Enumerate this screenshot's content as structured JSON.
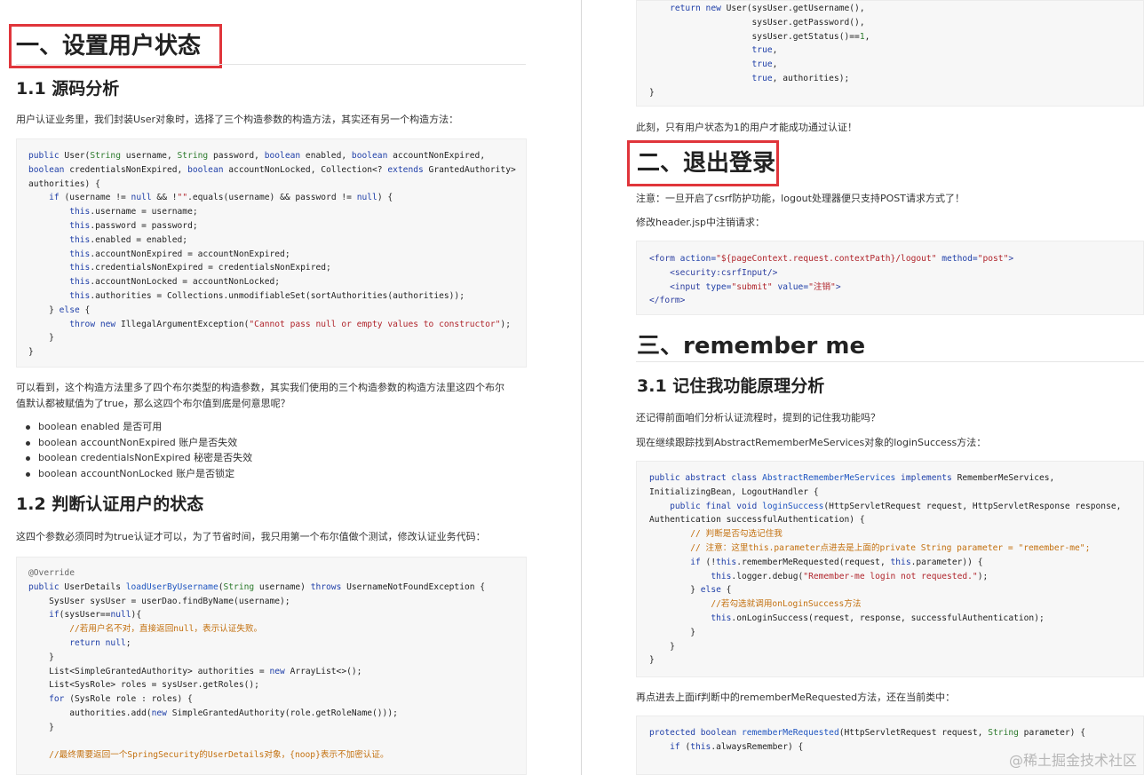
{
  "left": {
    "h1": "一、设置用户状态",
    "h2a": "1.1 源码分析",
    "p1": "用户认证业务里，我们封装User对象时，选择了三个构造参数的构造方法，其实还有另一个构造方法：",
    "p2_line1": "可以看到，这个构造方法里多了四个布尔类型的构造参数，其实我们使用的三个构造参数的构造方法里这四个布尔",
    "p2_line2": "值默认都被赋值为了true，那么这四个布尔值到底是何意思呢？",
    "bullets": [
      "boolean enabled 是否可用",
      "boolean accountNonExpired 账户是否失效",
      "boolean credentialsNonExpired 秘密是否失效",
      "boolean accountNonLocked 账户是否锁定"
    ],
    "h2b": "1.2 判断认证用户的状态",
    "p3": "这四个参数必须同时为true认证才可以，为了节省时间，我只用第一个布尔值做个测试，修改认证业务代码："
  },
  "right": {
    "p_ok": "此刻，只有用户状态为1的用户才能成功通过认证！",
    "h1b": "二、退出登录",
    "note": "注意：一旦开启了csrf防护功能，logout处理器便只支持POST请求方式了！",
    "modify": "修改header.jsp中注销请求：",
    "h1c": "三、remember me",
    "h2c": "3.1 记住我功能原理分析",
    "q1": "还记得前面咱们分析认证流程时，提到的记住我功能吗？",
    "q2": "现在继续跟踪找到AbstractRememberMeServices对象的loginSuccess方法：",
    "q3": "再点进去上面if判断中的rememberMeRequested方法，还在当前类中："
  },
  "watermark": "@稀土掘金技术社区"
}
